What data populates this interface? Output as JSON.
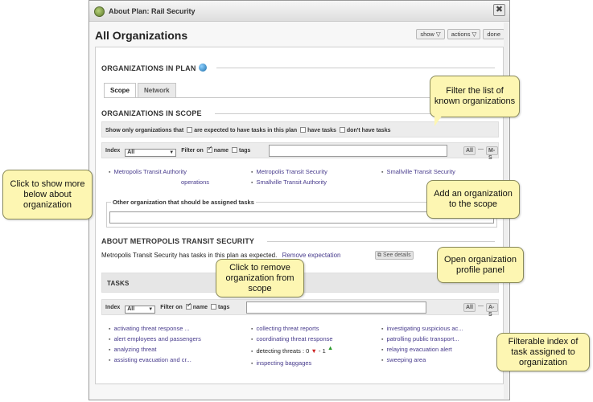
{
  "window": {
    "title": "About Plan: Rail Security",
    "close_glyph": "✖"
  },
  "header": {
    "title": "All Organizations",
    "buttons": {
      "show": "show ▽",
      "actions": "actions ▽",
      "done": "done"
    }
  },
  "plan_section": {
    "title": "ORGANIZATIONS IN PLAN"
  },
  "tabs": [
    {
      "label": "Scope",
      "active": true
    },
    {
      "label": "Network",
      "active": false
    }
  ],
  "scope_section": {
    "title": "ORGANIZATIONS IN SCOPE",
    "show_only_label": "Show only organizations that",
    "opt_expected": "are expected to have tasks in this plan",
    "opt_have_tasks": "have tasks",
    "opt_dont_have": "don't have tasks",
    "index_label": "Index",
    "index_value": "All",
    "filter_on_label": "Filter on",
    "filter_name": "name",
    "filter_tags": "tags",
    "btn_all": "All",
    "btn_dash": "—",
    "btn_range": "M-S",
    "orgs": [
      "Metropolis Transit Authority",
      "Metropolis Transit Security",
      "Smallville Transit Security",
      "operations",
      "Smallville Transit Authority"
    ],
    "other_org_legend": "Other organization that should be assigned tasks"
  },
  "about_section": {
    "title": "ABOUT METROPOLIS TRANSIT SECURITY",
    "status_text": "Metropolis Transit Security has tasks in this plan as expected.",
    "remove_link": "Remove expectation",
    "see_details": "See details"
  },
  "tasks_section": {
    "title": "TASKS",
    "index_label": "Index",
    "index_value": "All",
    "filter_on_label": "Filter on",
    "filter_name": "name",
    "filter_tags": "tags",
    "btn_all": "All",
    "btn_dash": "—",
    "btn_range": "A-S",
    "col1": [
      "activating threat response ...",
      "alert employees and passengers",
      "analyzing threat",
      "assisting evacuation and cr..."
    ],
    "col2": [
      "collecting threat reports",
      "coordinating threat response",
      "detecting threats : 0",
      "inspecting baggages"
    ],
    "detect_extra": "- 1",
    "col3": [
      "investigating suspicious ac...",
      "patrolling public transport...",
      "relaying evacuation alert",
      "sweeping area"
    ]
  },
  "callouts": {
    "filter": "Filter the list of known organizations",
    "show_more": "Click to show more below about organization",
    "add_org": "Add an organization to the scope",
    "remove": "Click to remove organization from scope",
    "profile": "Open organization profile panel",
    "index": "Filterable index of task assigned to organization"
  }
}
